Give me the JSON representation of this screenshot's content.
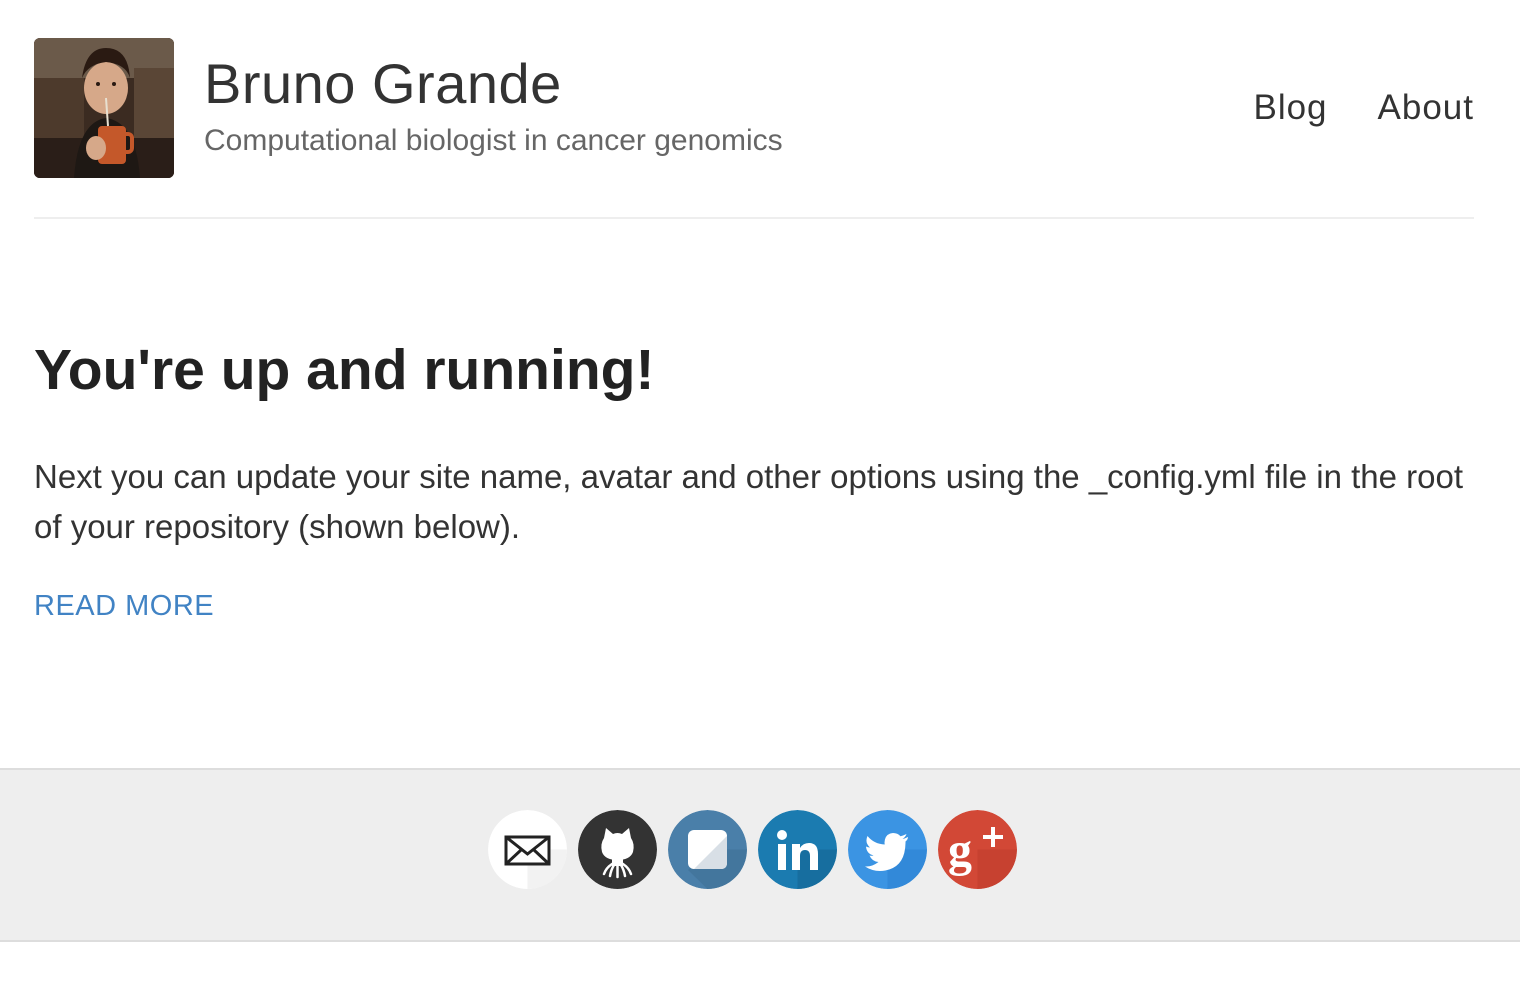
{
  "site": {
    "name": "Bruno Grande",
    "description": "Computational biologist in cancer genomics"
  },
  "nav": {
    "items": [
      {
        "label": "Blog"
      },
      {
        "label": "About"
      }
    ]
  },
  "post": {
    "title": "You're up and running!",
    "excerpt": "Next you can update your site name, avatar and other options using the _config.yml file in the root of your repository (shown below).",
    "read_more_label": "READ MORE"
  },
  "footer": {
    "social": [
      {
        "icon": "mail-icon",
        "color": "#ffffff"
      },
      {
        "icon": "github-icon",
        "color": "#333333"
      },
      {
        "icon": "stackexchange-icon",
        "color": "#4a7fa9"
      },
      {
        "icon": "linkedin-icon",
        "color": "#1b7bb0"
      },
      {
        "icon": "twitter-icon",
        "color": "#3b94e3"
      },
      {
        "icon": "googleplus-icon",
        "color": "#d24836"
      }
    ]
  },
  "colors": {
    "link": "#4183c4",
    "footer_bg": "#eeeeee",
    "divider": "#eeeeee"
  }
}
